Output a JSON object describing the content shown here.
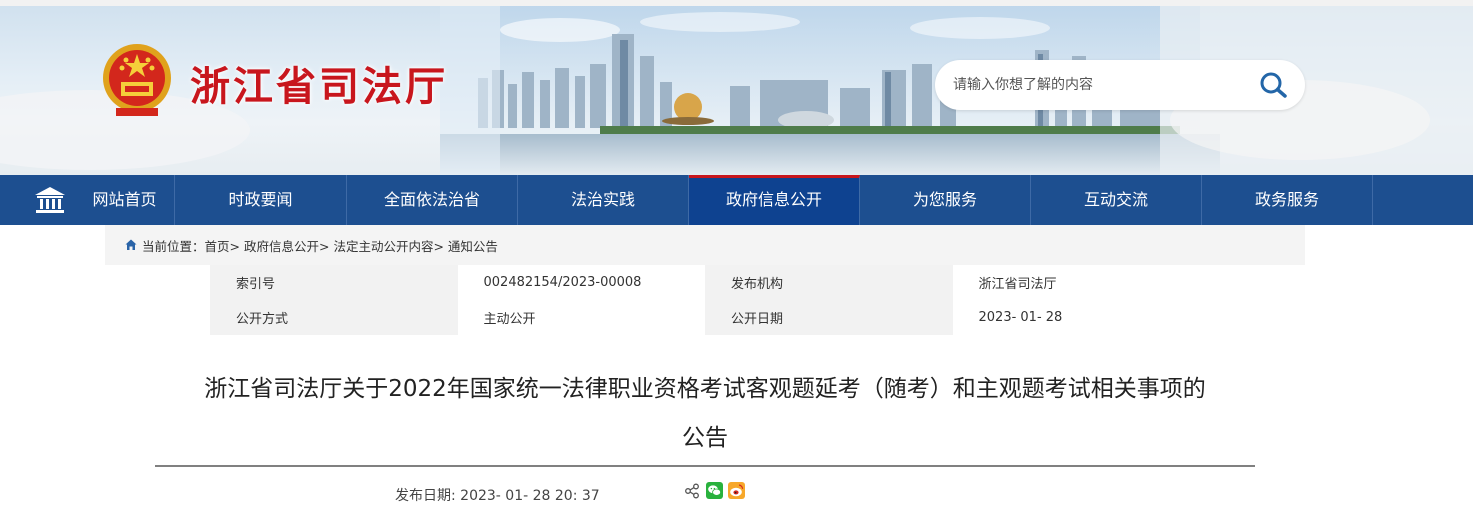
{
  "site": {
    "title": "浙江省司法厅",
    "search_placeholder": "请输入你想了解的内容"
  },
  "nav": {
    "items": [
      {
        "label": "网站首页"
      },
      {
        "label": "时政要闻"
      },
      {
        "label": "全面依法治省"
      },
      {
        "label": "法治实践"
      },
      {
        "label": "政府信息公开",
        "active": true
      },
      {
        "label": "为您服务"
      },
      {
        "label": "互动交流"
      },
      {
        "label": "政务服务"
      }
    ]
  },
  "breadcrumb": {
    "prefix": "当前位置：",
    "items": [
      "首页",
      "政府信息公开",
      "法定主动公开内容",
      "通知公告"
    ],
    "separator": "> "
  },
  "info": {
    "index_label": "索引号",
    "index_value": "002482154/2023-00008",
    "publisher_label": "发布机构",
    "publisher_value": "浙江省司法厅",
    "method_label": "公开方式",
    "method_value": "主动公开",
    "date_label": "公开日期",
    "date_value": "2023- 01- 28"
  },
  "article": {
    "title_line1": "浙江省司法厅关于2022年国家统一法律职业资格考试客观题延考（随考）和主观题考试相关事项的",
    "title_line2": "公告",
    "pubdate_label": "发布日期: ",
    "pubdate_value": "2023- 01- 28 20: 37"
  },
  "colors": {
    "nav_bg": "#1d4f90",
    "nav_active": "#0e4290",
    "title_red": "#c8161d"
  },
  "icons": [
    "national-emblem-icon",
    "search-icon",
    "home-icon",
    "breadcrumb-home-icon",
    "share-icon",
    "wechat-icon",
    "weibo-icon"
  ]
}
